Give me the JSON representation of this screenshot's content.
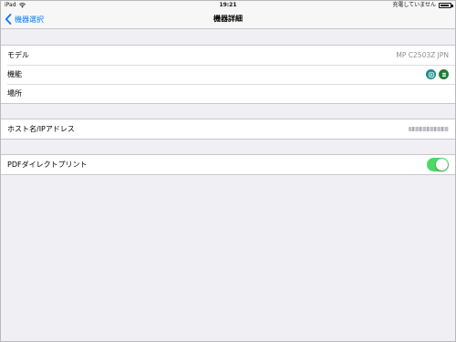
{
  "status_bar": {
    "device": "iPad",
    "time": "19:21",
    "battery_text": "充電していません",
    "battery_level": 0.85
  },
  "nav": {
    "back_label": "機器選択",
    "title": "機器詳細"
  },
  "device_info": {
    "model_label": "モデル",
    "model_value": "MP C2503Z JPN",
    "function_label": "機能",
    "location_label": "場所",
    "location_value": ""
  },
  "network": {
    "host_label": "ホスト名/IPアドレス"
  },
  "pdf": {
    "label": "PDFダイレクトプリント",
    "enabled": true
  },
  "colors": {
    "accent": "#007aff",
    "toggle_on": "#4cd964",
    "function_icon_1": "#1a8f8a",
    "function_icon_2": "#1e7e34"
  }
}
